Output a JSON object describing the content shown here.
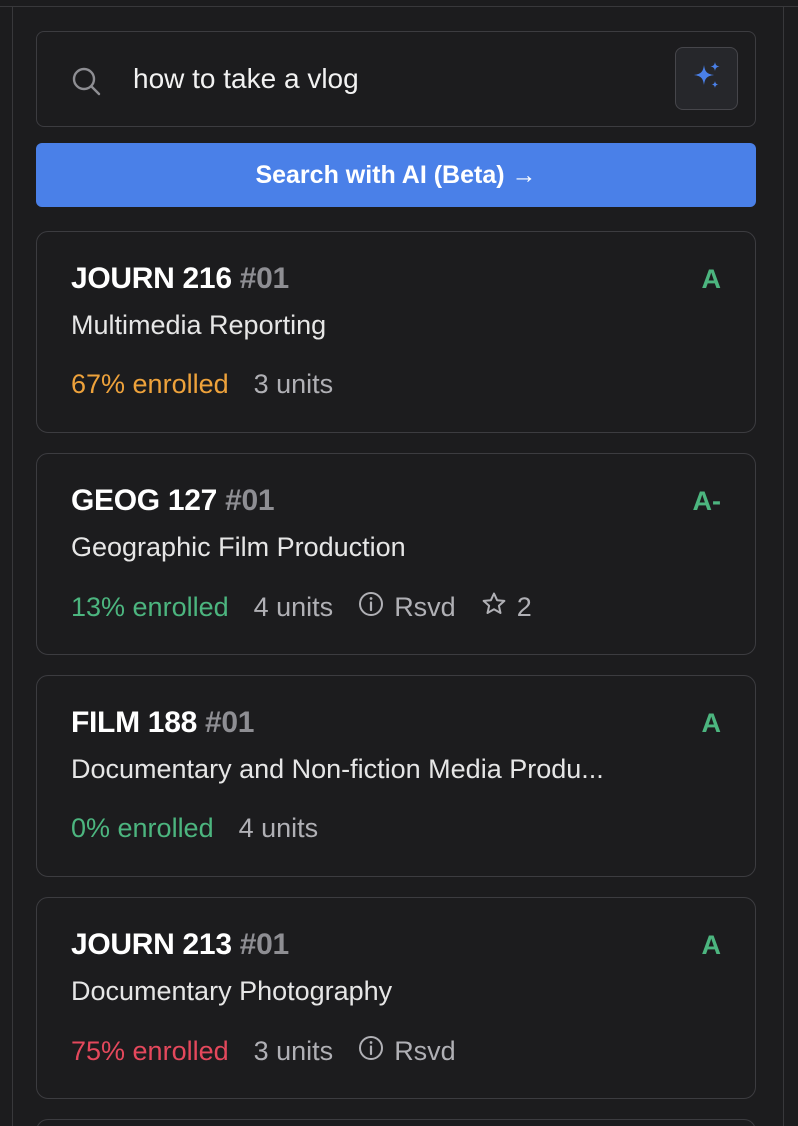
{
  "search": {
    "query": "how to take a vlog",
    "ai_button_label": "Search with AI (Beta) →"
  },
  "colors": {
    "accent": "#4a80e8",
    "grade_green": "#4cb57f",
    "enroll_low": "#4cb57f",
    "enroll_mid": "#eea23b",
    "enroll_high": "#e4485c"
  },
  "courses": [
    {
      "code": "JOURN 216",
      "section": "#01",
      "grade": "A",
      "title": "Multimedia Reporting",
      "enrolled": "67% enrolled",
      "units": "3 units",
      "rsvd": "",
      "favorites": ""
    },
    {
      "code": "GEOG 127",
      "section": "#01",
      "grade": "A-",
      "title": "Geographic Film Production",
      "enrolled": "13% enrolled",
      "units": "4 units",
      "rsvd": "Rsvd",
      "favorites": "2"
    },
    {
      "code": "FILM 188",
      "section": "#01",
      "grade": "A",
      "title": "Documentary and Non-fiction Media Produ...",
      "enrolled": "0% enrolled",
      "units": "4 units",
      "rsvd": "",
      "favorites": ""
    },
    {
      "code": "JOURN 213",
      "section": "#01",
      "grade": "A",
      "title": "Documentary Photography",
      "enrolled": "75% enrolled",
      "units": "3 units",
      "rsvd": "Rsvd",
      "favorites": ""
    }
  ]
}
